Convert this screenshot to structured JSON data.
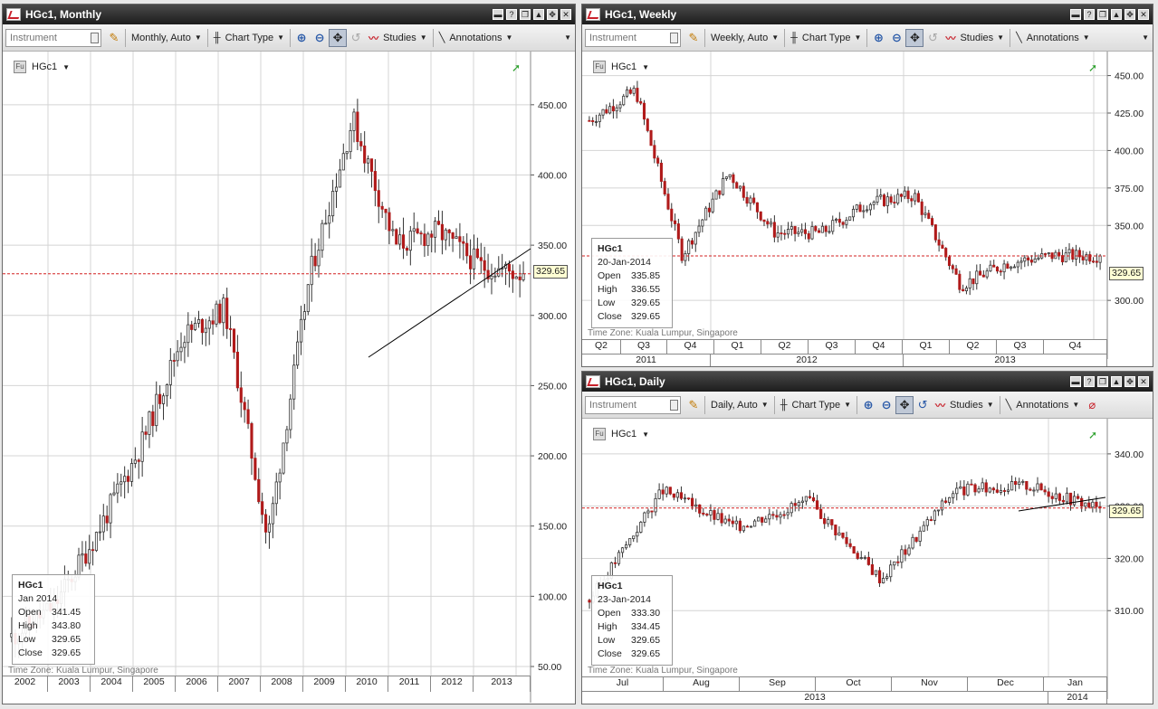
{
  "toolbar": {
    "instrument_placeholder": "Instrument",
    "chart_type": "Chart Type",
    "studies": "Studies",
    "annotations": "Annotations"
  },
  "monthly": {
    "title": "HGc1, Monthly",
    "interval": "Monthly,  Auto",
    "symbol": "HGc1",
    "y_ticks": [
      "450.00",
      "400.00",
      "350.00",
      "300.00",
      "250.00",
      "200.00",
      "150.00",
      "100.00",
      "50.00"
    ],
    "years": [
      "2002",
      "2003",
      "2004",
      "2005",
      "2006",
      "2007",
      "2008",
      "2009",
      "2010",
      "2011",
      "2012",
      "2013"
    ],
    "last_price": "329.65",
    "info": {
      "name": "HGc1",
      "date": "Jan 2014",
      "open": "341.45",
      "high": "343.80",
      "low": "329.65",
      "close": "329.65"
    },
    "timezone": "Time Zone: Kuala Lumpur, Singapore"
  },
  "weekly": {
    "title": "HGc1, Weekly",
    "interval": "Weekly,  Auto",
    "symbol": "HGc1",
    "y_ticks": [
      "450.00",
      "425.00",
      "400.00",
      "375.00",
      "350.00",
      "300.00"
    ],
    "quarters": [
      "Q2",
      "Q3",
      "Q4",
      "Q1",
      "Q2",
      "Q3",
      "Q4",
      "Q1",
      "Q2",
      "Q3",
      "Q4"
    ],
    "years": [
      "2011",
      "2012",
      "2013"
    ],
    "last_price": "329.65",
    "info": {
      "name": "HGc1",
      "date": "20-Jan-2014",
      "open": "335.85",
      "high": "336.55",
      "low": "329.65",
      "close": "329.65"
    },
    "timezone": "Time Zone: Kuala Lumpur, Singapore"
  },
  "daily": {
    "title": "HGc1, Daily",
    "interval": "Daily,  Auto",
    "symbol": "HGc1",
    "y_ticks": [
      "340.00",
      "330.00",
      "320.00",
      "310.00"
    ],
    "months": [
      "Jul",
      "Aug",
      "Sep",
      "Oct",
      "Nov",
      "Dec",
      "Jan"
    ],
    "years": [
      "2013",
      "2014"
    ],
    "last_price": "329.65",
    "info": {
      "name": "HGc1",
      "date": "23-Jan-2014",
      "open": "333.30",
      "high": "334.45",
      "low": "329.65",
      "close": "329.65"
    },
    "timezone": "Time Zone: Kuala Lumpur, Singapore"
  },
  "info_labels": {
    "open": "Open",
    "high": "High",
    "low": "Low",
    "close": "Close"
  },
  "colors": {
    "up": "#2e7d32",
    "down": "#b01a1a",
    "grid": "#d4d4d4",
    "trend": "#000000",
    "last_line": "#d32020"
  },
  "chart_data": [
    {
      "type": "candlestick",
      "title": "HGc1, Monthly",
      "ylim": [
        50,
        475
      ],
      "x": [
        "2002",
        "2003",
        "2004",
        "2005",
        "2006",
        "2007",
        "2008",
        "2009",
        "2010",
        "2011",
        "2012",
        "2013",
        "2014"
      ],
      "close": [
        71,
        93,
        145,
        205,
        285,
        305,
        140,
        330,
        440,
        350,
        360,
        335,
        329.65
      ]
    },
    {
      "type": "candlestick",
      "title": "HGc1, Weekly",
      "ylim": [
        285,
        460
      ],
      "x": [
        "2011-Q2",
        "2011-Q3",
        "2011-Q4",
        "2012-Q1",
        "2012-Q2",
        "2012-Q3",
        "2012-Q4",
        "2013-Q1",
        "2013-Q2",
        "2013-Q3",
        "2013-Q4",
        "2014-Jan"
      ],
      "close": [
        420,
        440,
        330,
        385,
        345,
        345,
        365,
        370,
        310,
        325,
        330,
        329.65
      ]
    },
    {
      "type": "candlestick",
      "title": "HGc1, Daily",
      "ylim": [
        300,
        345
      ],
      "x": [
        "Jul",
        "Aug",
        "Sep",
        "Oct",
        "Nov",
        "Dec",
        "Jan"
      ],
      "close": [
        312,
        333,
        326,
        331,
        316,
        333,
        334,
        329.65
      ]
    }
  ]
}
